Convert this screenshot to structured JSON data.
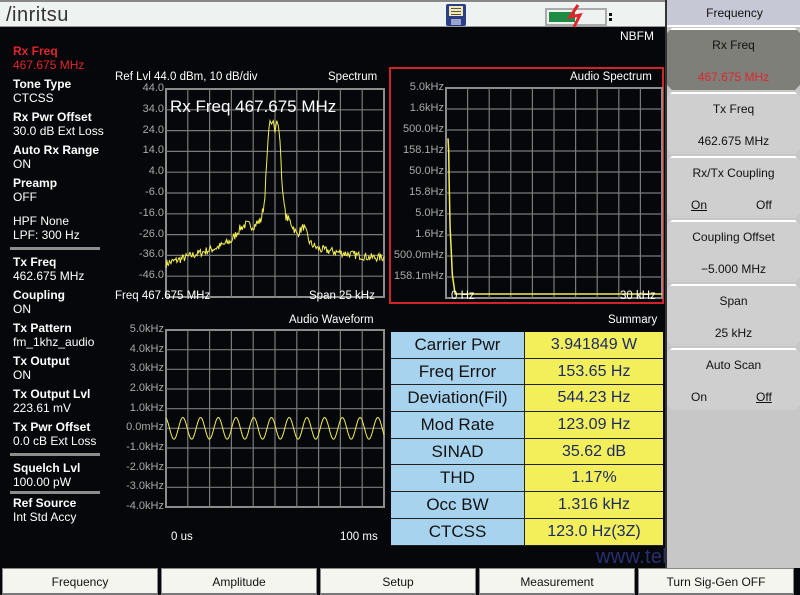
{
  "header": {
    "logo": "/inritsu",
    "mode": "NBFM",
    "icons": [
      "save-icon",
      "battery-icon",
      "charging-icon"
    ],
    "battery_level": 0.45
  },
  "left_panel": {
    "items": [
      {
        "label": "Rx Freq",
        "value": "467.675 MHz",
        "highlight": true
      },
      {
        "label": "Tone Type",
        "value": "CTCSS"
      },
      {
        "label": "Rx Pwr Offset",
        "value": "30.0 dB Ext Loss"
      },
      {
        "label": "Auto Rx Range",
        "value": "ON"
      },
      {
        "label": "Preamp",
        "value": "OFF"
      }
    ],
    "filters": {
      "hpf": "HPF  None",
      "lpf": "LPF: 300 Hz"
    },
    "tx_items": [
      {
        "label": "Tx Freq",
        "value": "462.675 MHz"
      },
      {
        "label": "Coupling",
        "value": "ON"
      },
      {
        "label": "Tx Pattern",
        "value": "fm_1khz_audio"
      },
      {
        "label": "Tx Output",
        "value": "ON"
      },
      {
        "label": "Tx Output Lvl",
        "value": "223.61 mV"
      },
      {
        "label": "Tx Pwr Offset",
        "value": "0.0 cB Ext Loss"
      }
    ],
    "squelch": {
      "label": "Squelch Lvl",
      "value": "100.00 pW"
    },
    "ref": {
      "label": "Ref Source",
      "value": "Int Std Accy"
    }
  },
  "spectrum": {
    "header_left": "Ref Lvl 44.0 dBm,  10 dB/div",
    "title": "Spectrum",
    "marker_label": "Rx Freq 467.675 MHz",
    "footer_left": "Freq 467.675 MHz",
    "footer_right": "Span 25 kHz"
  },
  "audio_spectrum": {
    "title": "Audio Spectrum",
    "footer_left": "0 Hz",
    "footer_right": "30 kHz"
  },
  "audio_waveform": {
    "title": "Audio Waveform",
    "footer_left": "0 us",
    "footer_right": "100 ms"
  },
  "summary": {
    "title": "Summary",
    "rows": [
      {
        "key": "Carrier Pwr",
        "value": "3.941849 W"
      },
      {
        "key": "Freq Error",
        "value": "153.65 Hz"
      },
      {
        "key": "Deviation(Fil)",
        "value": "544.23 Hz"
      },
      {
        "key": "Mod Rate",
        "value": "123.09 Hz"
      },
      {
        "key": "SINAD",
        "value": "35.62 dB"
      },
      {
        "key": "THD",
        "value": "1.17%"
      },
      {
        "key": "Occ BW",
        "value": "1.316 kHz"
      },
      {
        "key": "CTCSS",
        "value": "123.0 Hz(3Z)"
      }
    ]
  },
  "watermark": "www.tehencom.com",
  "right_panel": {
    "title": "Frequency",
    "softkeys": [
      {
        "label": "Rx Freq",
        "value": "467.675 MHz",
        "active": true
      },
      {
        "label": "Tx Freq",
        "value": "462.675 MHz"
      },
      {
        "label": "Rx/Tx Coupling",
        "options": [
          "On",
          "Off"
        ],
        "selected": "On"
      },
      {
        "label": "Coupling Offset",
        "value": "−5.000 MHz"
      },
      {
        "label": "Span",
        "value": "25 kHz"
      },
      {
        "label": "Auto Scan",
        "options": [
          "On",
          "Off"
        ],
        "selected": "Off"
      }
    ]
  },
  "bottom_bar": {
    "buttons": [
      "Frequency",
      "Amplitude",
      "Setup",
      "Measurement",
      "Turn Sig-Gen OFF"
    ]
  },
  "chart_data": [
    {
      "type": "line",
      "title": "Spectrum",
      "xlabel": "Freq 467.675 MHz",
      "x_range_khz": [
        -12.5,
        12.5
      ],
      "ylabel": "dBm",
      "ylim": [
        -56,
        44
      ],
      "y_ticks": [
        "44.0",
        "34.0",
        "24.0",
        "14.0",
        "4.0",
        "-6.0",
        "-16.0",
        "-26.0",
        "-36.0",
        "-46.0"
      ],
      "grid": true,
      "series": [
        {
          "name": "Spectrum trace",
          "x_khz": [
            -12.5,
            -11,
            -9.5,
            -8,
            -6.5,
            -5,
            -4,
            -3.3,
            -2.5,
            -1.6,
            -1.2,
            -0.8,
            -0.6,
            -0.4,
            -0.2,
            0,
            0.2,
            0.4,
            0.6,
            0.8,
            1.2,
            1.8,
            2.5,
            3.3,
            4,
            5,
            6.5,
            8,
            9.5,
            11,
            12.5
          ],
          "y_dbm": [
            -40,
            -38,
            -36,
            -34,
            -32,
            -29,
            -23,
            -21,
            -22,
            -19,
            -10,
            20,
            29,
            27,
            29,
            23,
            29,
            26,
            18,
            -2,
            -17,
            -20,
            -26,
            -22,
            -30,
            -33,
            -34,
            -35,
            -36,
            -37,
            -37
          ]
        }
      ]
    },
    {
      "type": "line",
      "title": "Audio Spectrum",
      "x_range": [
        "0 Hz",
        "30 kHz"
      ],
      "y_ticks": [
        "5.0kHz",
        "1.6kHz",
        "500.0Hz",
        "158.1Hz",
        "50.0Hz",
        "15.8Hz",
        "5.0Hz",
        "1.6Hz",
        "500.0mHz",
        "158.1mHz"
      ],
      "y_scale": "log",
      "grid": true,
      "series": [
        {
          "name": "Audio spectrum trace",
          "x_khz": [
            0,
            0.1,
            0.15,
            0.3,
            0.45,
            0.6,
            1,
            30
          ],
          "y_hz": [
            300,
            150,
            30,
            2,
            0.6,
            0.15,
            0.05,
            0.05
          ]
        }
      ]
    },
    {
      "type": "line",
      "title": "Audio Waveform",
      "x_range": [
        "0 us",
        "100 ms"
      ],
      "y_ticks": [
        "5.0kHz",
        "4.0kHz",
        "3.0kHz",
        "2.0kHz",
        "1.0kHz",
        "0.0mHz",
        "-1.0kHz",
        "-2.0kHz",
        "-3.0kHz",
        "-4.0kHz"
      ],
      "ylim_khz": [
        -5,
        5
      ],
      "grid": true,
      "series": [
        {
          "name": "Audio waveform",
          "shape": "sine",
          "amplitude_khz": 0.55,
          "cycles": 12.3
        }
      ]
    }
  ]
}
